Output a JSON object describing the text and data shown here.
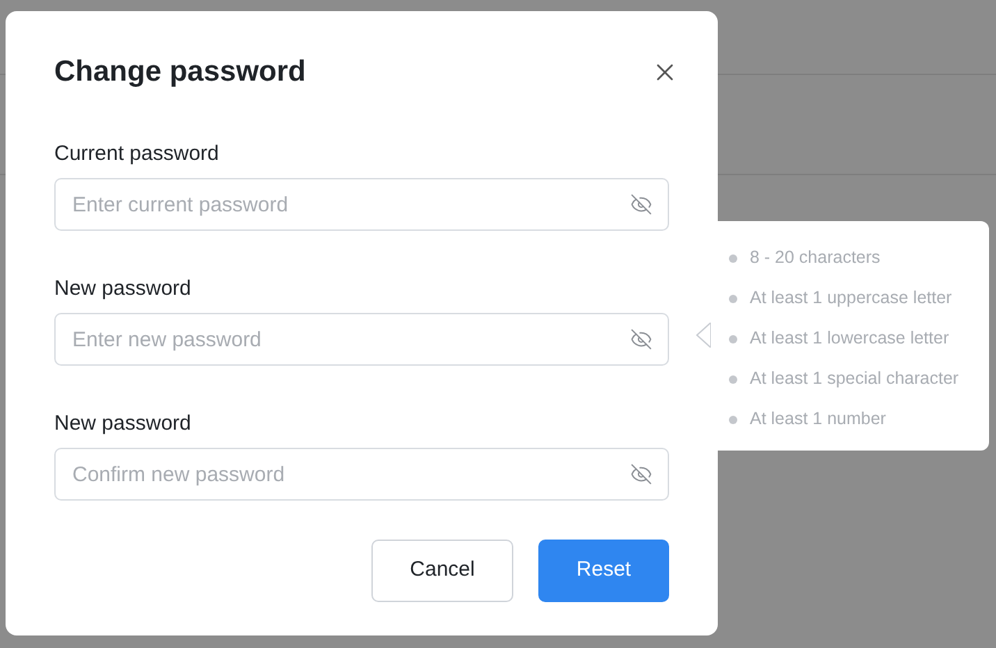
{
  "dialog": {
    "title": "Change password",
    "fields": [
      {
        "label": "Current password",
        "placeholder": "Enter current password"
      },
      {
        "label": "New password",
        "placeholder": "Enter new password"
      },
      {
        "label": "New password",
        "placeholder": "Confirm new password"
      }
    ],
    "buttons": [
      {
        "label": "Cancel",
        "kind": "secondary"
      },
      {
        "label": "Reset",
        "kind": "primary"
      }
    ]
  },
  "password_rules": [
    "8 - 20 characters",
    "At least 1 uppercase letter",
    "At least 1 lowercase letter",
    "At least 1 special character",
    "At least 1 number"
  ]
}
